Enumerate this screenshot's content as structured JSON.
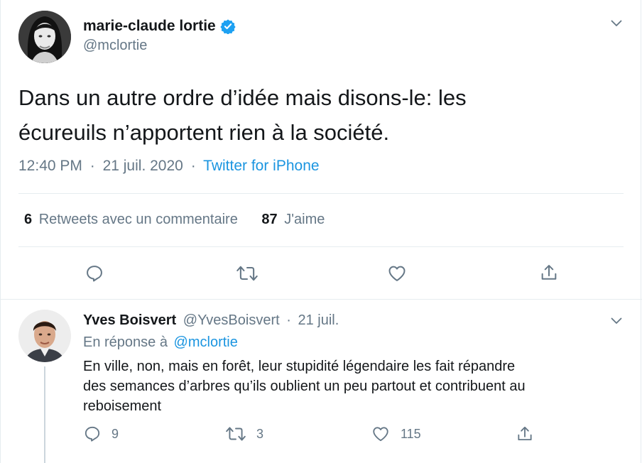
{
  "tweet": {
    "author_name": "marie-claude lortie",
    "author_handle": "@mclortie",
    "text_line1": "Dans un autre ordre d’idée mais disons-le: les",
    "text_line2": "écureuils n’apportent rien à la société.",
    "time": "12:40 PM",
    "date": "21 juil. 2020",
    "separator": "·",
    "source": "Twitter for iPhone",
    "retweets_count": "6",
    "retweets_label": "Retweets avec un commentaire",
    "likes_count": "87",
    "likes_label": "J'aime"
  },
  "reply": {
    "author_name": "Yves Boisvert",
    "author_handle": "@YvesBoisvert",
    "separator": "·",
    "date": "21 juil.",
    "in_reply_prefix": "En réponse à",
    "in_reply_handle": "@mclortie",
    "text_line1": "En ville, non, mais en forêt, leur stupidité légendaire les fait répandre",
    "text_line2": "des semances d’arbres qu’ils oublient un peu partout et contribuent au",
    "text_line3": "reboisement",
    "reply_count": "9",
    "retweet_count": "3",
    "like_count": "115"
  },
  "icons": {
    "verified": "verified-badge-icon",
    "caret": "chevron-down-icon",
    "reply": "reply-icon",
    "retweet": "retweet-icon",
    "like": "heart-icon",
    "share": "share-icon"
  },
  "colors": {
    "text": "#14171a",
    "muted": "#657786",
    "link": "#1b95e0",
    "divider": "#e6ecf0"
  }
}
